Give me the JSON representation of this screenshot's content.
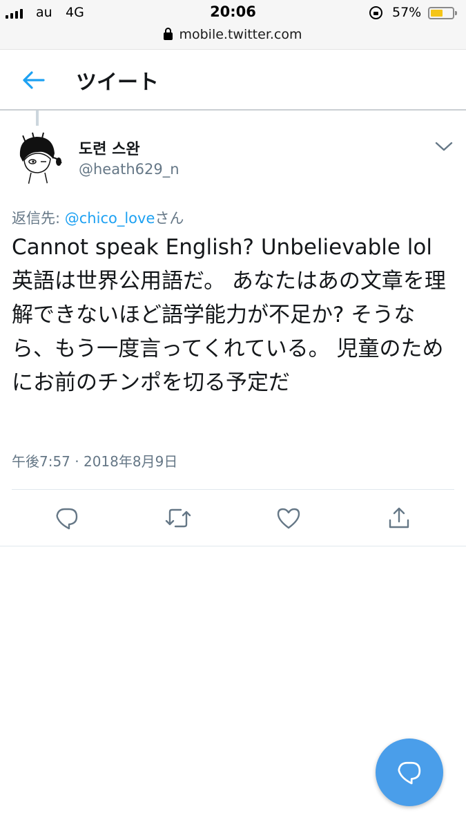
{
  "status_bar": {
    "carrier": "au",
    "network": "4G",
    "time": "20:06",
    "battery_percent": "57%",
    "battery_level": 0.57,
    "battery_color": "#f5c518"
  },
  "browser": {
    "url": "mobile.twitter.com",
    "lock_icon": "lock-icon"
  },
  "header": {
    "back_icon": "arrow-left-icon",
    "title": "ツイート"
  },
  "tweet": {
    "display_name": "도련 스완",
    "handle": "@heath629_n",
    "reply_prefix": "返信先: ",
    "reply_mention": "@chico_love",
    "reply_suffix": "さん",
    "text": "Cannot speak English? Unbelievable lol 英語は世界公用語だ。 あなたはあの文章を理解できないほど語学能力が不足か? そうなら、もう一度言ってくれている。 児童のためにお前のチンポを切る予定だ",
    "timestamp": "午後7:57 · 2018年8月9日",
    "actions": [
      "reply-icon",
      "retweet-icon",
      "like-icon",
      "share-icon"
    ]
  },
  "fab": {
    "icon": "compose-reply-icon",
    "color": "#4a9eea"
  },
  "colors": {
    "accent": "#1da1f2",
    "secondary_text": "#657786",
    "primary_text": "#14171a"
  }
}
